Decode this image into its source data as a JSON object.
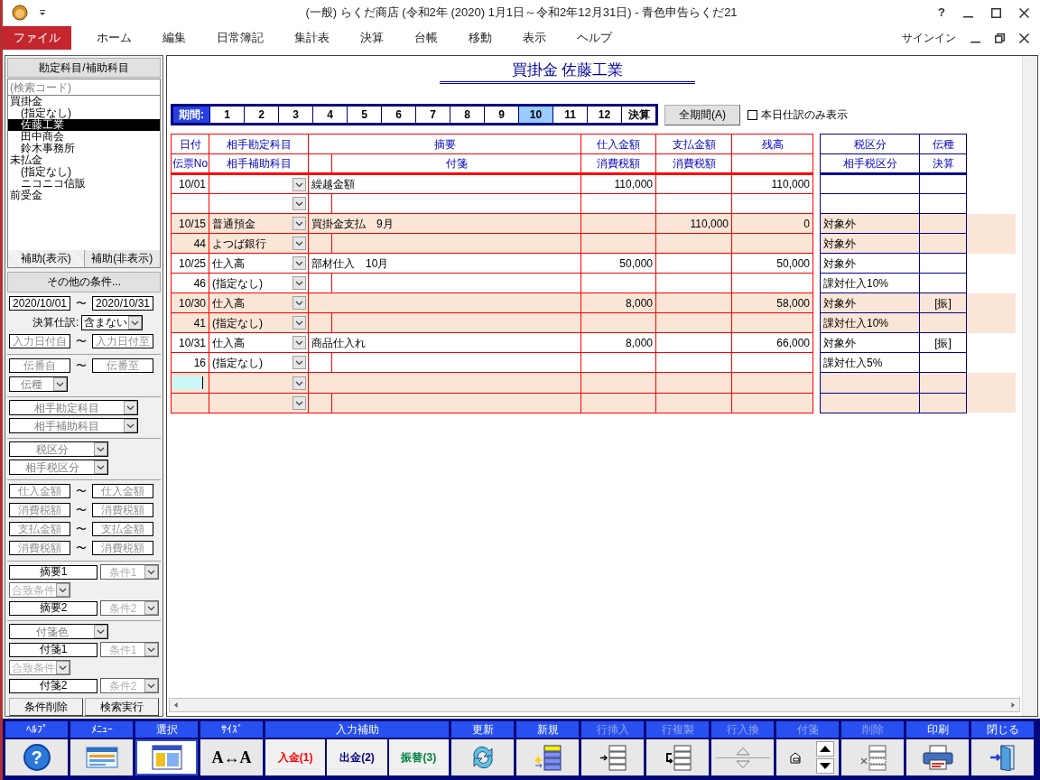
{
  "window": {
    "title": "(一般) らくだ商店 (令和2年 (2020) 1月1日～令和2年12月31日) - 青色申告らくだ21",
    "help": "?"
  },
  "menu": [
    {
      "label": "ファイル",
      "selected": true
    },
    {
      "label": "ホーム",
      "selected": false
    },
    {
      "label": "編集",
      "selected": false
    },
    {
      "label": "日常簿記",
      "selected": false
    },
    {
      "label": "集計表",
      "selected": false
    },
    {
      "label": "決算",
      "selected": false
    },
    {
      "label": "台帳",
      "selected": false
    },
    {
      "label": "移動",
      "selected": false
    },
    {
      "label": "表示",
      "selected": false
    },
    {
      "label": "ヘルプ",
      "selected": false
    }
  ],
  "signin": "サインイン",
  "left_panel": {
    "header": "勘定科目/補助科目",
    "search_placeholder": "(検索コード)",
    "tree": [
      {
        "label": "買掛金",
        "selected": false,
        "children": [
          {
            "label": "(指定なし)",
            "selected": false
          },
          {
            "label": "佐藤工業",
            "selected": true
          },
          {
            "label": "田中商会",
            "selected": false
          },
          {
            "label": "鈴木事務所",
            "selected": false
          }
        ]
      },
      {
        "label": "未払金",
        "selected": false,
        "children": [
          {
            "label": "(指定なし)",
            "selected": false
          },
          {
            "label": "ニコニコ信販",
            "selected": false
          }
        ]
      },
      {
        "label": "前受金",
        "selected": false
      }
    ],
    "tabs": [
      {
        "label": "補助(表示)",
        "selected": true
      },
      {
        "label": "補助(非表示)",
        "selected": false
      }
    ],
    "other_conditions": "その他の条件...",
    "filter_groups": [
      [
        [
          {
            "kind": "input",
            "value": "2020/10/01"
          },
          {
            "kind": "tilde",
            "text": "〜"
          },
          {
            "kind": "input",
            "value": "2020/10/31"
          }
        ],
        [
          {
            "kind": "label",
            "text": "決算仕訳:"
          },
          {
            "kind": "select",
            "value": "含まない",
            "disabled": false
          }
        ],
        [
          {
            "kind": "input",
            "placeholder": "入力日付自"
          },
          {
            "kind": "tilde",
            "text": "〜"
          },
          {
            "kind": "input",
            "placeholder": "入力日付至"
          }
        ]
      ],
      [
        [
          {
            "kind": "input",
            "placeholder": "伝番自"
          },
          {
            "kind": "tilde",
            "text": "〜"
          },
          {
            "kind": "input",
            "placeholder": "伝番至"
          }
        ],
        [
          {
            "kind": "select",
            "placeholder": "伝種",
            "disabled": false
          }
        ]
      ],
      [
        [
          {
            "kind": "select",
            "placeholder": "相手勘定科目",
            "disabled": false
          }
        ],
        [
          {
            "kind": "select",
            "placeholder": "相手補助科目",
            "disabled": false
          }
        ]
      ],
      [
        [
          {
            "kind": "select",
            "placeholder": "税区分",
            "disabled": false
          }
        ],
        [
          {
            "kind": "select",
            "placeholder": "相手税区分",
            "disabled": false
          }
        ]
      ],
      [
        [
          {
            "kind": "input",
            "placeholder": "仕入金額"
          },
          {
            "kind": "tilde",
            "text": "〜"
          },
          {
            "kind": "input",
            "placeholder": "仕入金額"
          }
        ],
        [
          {
            "kind": "input",
            "placeholder": "消費税額"
          },
          {
            "kind": "tilde",
            "text": "〜"
          },
          {
            "kind": "input",
            "placeholder": "消費税額"
          }
        ],
        [
          {
            "kind": "input",
            "placeholder": "支払金額"
          },
          {
            "kind": "tilde",
            "text": "〜"
          },
          {
            "kind": "input",
            "placeholder": "支払金額"
          }
        ],
        [
          {
            "kind": "input",
            "placeholder": "消費税額"
          },
          {
            "kind": "tilde",
            "text": "〜"
          },
          {
            "kind": "input",
            "placeholder": "消費税額"
          }
        ]
      ],
      [
        [
          {
            "kind": "input",
            "value": "摘要1"
          },
          {
            "kind": "select",
            "placeholder": "条件1",
            "disabled": true
          }
        ],
        [
          {
            "kind": "select",
            "placeholder": "合致条件",
            "disabled": true
          }
        ],
        [
          {
            "kind": "input",
            "value": "摘要2"
          },
          {
            "kind": "select",
            "placeholder": "条件2",
            "disabled": true
          }
        ]
      ],
      [
        [
          {
            "kind": "select",
            "placeholder": "付箋色",
            "disabled": false
          }
        ],
        [
          {
            "kind": "input",
            "value": "付箋1"
          },
          {
            "kind": "select",
            "placeholder": "条件1",
            "disabled": true
          }
        ],
        [
          {
            "kind": "select",
            "placeholder": "合致条件",
            "disabled": true
          }
        ],
        [
          {
            "kind": "input",
            "value": "付箋2"
          },
          {
            "kind": "select",
            "placeholder": "条件2",
            "disabled": true
          }
        ]
      ]
    ],
    "buttons": [
      "条件削除",
      "検索実行"
    ]
  },
  "ledger": {
    "title": "買掛金 佐藤工業",
    "period_label": "期間:",
    "periods": [
      {
        "label": "1",
        "selected": false
      },
      {
        "label": "2",
        "selected": false
      },
      {
        "label": "3",
        "selected": false
      },
      {
        "label": "4",
        "selected": false
      },
      {
        "label": "5",
        "selected": false
      },
      {
        "label": "6",
        "selected": false
      },
      {
        "label": "7",
        "selected": false
      },
      {
        "label": "8",
        "selected": false
      },
      {
        "label": "9",
        "selected": false
      },
      {
        "label": "10",
        "selected": true
      },
      {
        "label": "11",
        "selected": false
      },
      {
        "label": "12",
        "selected": false
      },
      {
        "label": "決算",
        "selected": false
      }
    ],
    "all_period_button": "全期間(A)",
    "today_only": {
      "label": "本日仕訳のみ表示",
      "checked": false
    },
    "columns": [
      {
        "top": "日付",
        "bottom": "伝票No"
      },
      {
        "top": "相手勘定科目",
        "bottom": "相手補助科目"
      },
      {
        "top": "摘要",
        "bottom": "付箋"
      },
      {
        "top": "仕入金額",
        "bottom": "消費税額"
      },
      {
        "top": "支払金額",
        "bottom": "消費税額"
      },
      {
        "top": "残高"
      },
      {
        "top": "税区分",
        "bottom": "相手税区分"
      },
      {
        "top": "伝種",
        "bottom": "決算"
      }
    ],
    "entries": [
      {
        "date": "10/01",
        "description": "繰越金額",
        "purchase": "110,000",
        "balance": "110,000",
        "editing": false
      },
      {
        "date": "10/15",
        "slip_no": "44",
        "account": "普通預金",
        "sub_account": "よつば銀行",
        "description": "買掛金支払　9月",
        "payment": "110,000",
        "balance": "0",
        "tax_class": "対象外",
        "partner_tax_class": "対象外",
        "editing": false
      },
      {
        "date": "10/25",
        "slip_no": "46",
        "account": "仕入高",
        "sub_account": "(指定なし)",
        "description": "部材仕入　10月",
        "purchase": "50,000",
        "balance": "50,000",
        "tax_class": "対象外",
        "partner_tax_class": "課対仕入10%",
        "editing": false
      },
      {
        "date": "10/30",
        "slip_no": "41",
        "account": "仕入高",
        "sub_account": "(指定なし)",
        "purchase": "8,000",
        "balance": "58,000",
        "tax_class": "対象外",
        "partner_tax_class": "課対仕入10%",
        "slip_type": "[振]",
        "editing": false
      },
      {
        "date": "10/31",
        "slip_no": "16",
        "account": "仕入高",
        "sub_account": "(指定なし)",
        "description": "商品仕入れ",
        "purchase": "8,000",
        "balance": "66,000",
        "tax_class": "対象外",
        "partner_tax_class": "課対仕入5%",
        "slip_type": "[振]",
        "editing": false
      },
      {
        "editing": true
      }
    ]
  },
  "toolbar": [
    {
      "kind": "tool",
      "label": "ﾍﾙﾌﾟ",
      "glyph": "?",
      "disabled": false,
      "selected": false
    },
    {
      "kind": "tool",
      "label": "ﾒﾆｭｰ",
      "disabled": false,
      "selected": false
    },
    {
      "kind": "tool",
      "label": "選択",
      "disabled": false,
      "selected": true
    },
    {
      "kind": "tool",
      "label": "ｻｲｽﾞ",
      "glyph": "A↔A",
      "disabled": false,
      "selected": false
    },
    {
      "kind": "group",
      "label": "入力補助",
      "buttons": [
        {
          "label": "入金(1)",
          "color": "#ff0000"
        },
        {
          "label": "出金(2)",
          "color": "#000080"
        },
        {
          "label": "振替(3)",
          "color": "#008040"
        }
      ]
    },
    {
      "kind": "tool",
      "label": "更新",
      "disabled": false,
      "selected": false
    },
    {
      "kind": "tool",
      "label": "新規",
      "disabled": false,
      "selected": false
    },
    {
      "kind": "tool",
      "label": "行挿入",
      "disabled": true,
      "selected": false
    },
    {
      "kind": "tool",
      "label": "行複製",
      "disabled": true,
      "selected": false
    },
    {
      "kind": "stepper",
      "label": "行入換",
      "disabled": true,
      "selected": false
    },
    {
      "kind": "tool",
      "label": "付箋",
      "disabled": true,
      "selected": false
    },
    {
      "kind": "tool",
      "label": "削除",
      "disabled": true,
      "selected": false
    },
    {
      "kind": "tool",
      "label": "印刷",
      "disabled": false,
      "selected": false
    },
    {
      "kind": "tool",
      "label": "閉じる",
      "disabled": false,
      "selected": false
    }
  ]
}
